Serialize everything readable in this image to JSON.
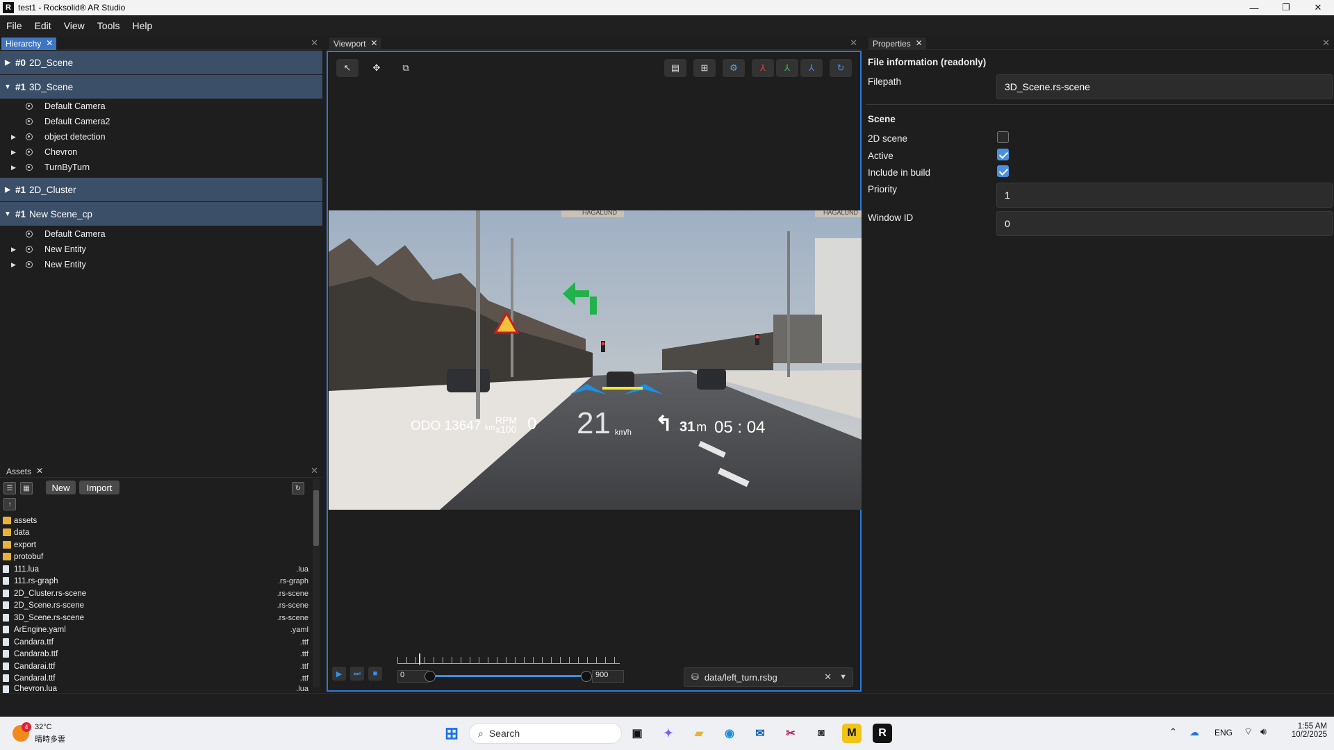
{
  "window": {
    "title": "test1 - Rocksolid® AR Studio",
    "logo": "R",
    "minimize": "—",
    "maximize": "❐",
    "close": "✕"
  },
  "menu": [
    "File",
    "Edit",
    "View",
    "Tools",
    "Help"
  ],
  "hierarchy": {
    "tab": "Hierarchy",
    "scenes": [
      {
        "index": "#0",
        "name": "2D_Scene",
        "expanded": false
      },
      {
        "index": "#1",
        "name": "3D_Scene",
        "expanded": true,
        "entities": [
          "Default Camera",
          "Default Camera2",
          "object detection",
          "Chevron",
          "TurnByTurn"
        ]
      },
      {
        "index": "#1",
        "name": "2D_Cluster",
        "expanded": false
      },
      {
        "index": "#1",
        "name": "New Scene_cp",
        "expanded": true,
        "entities": [
          "Default Camera",
          "New Entity",
          "New Entity"
        ]
      }
    ]
  },
  "assets": {
    "tab": "Assets",
    "new_label": "New",
    "import_label": "Import",
    "items": [
      {
        "name": "assets",
        "ext": "",
        "type": "folder"
      },
      {
        "name": "data",
        "ext": "",
        "type": "folder"
      },
      {
        "name": "export",
        "ext": "",
        "type": "folder"
      },
      {
        "name": "protobuf",
        "ext": "",
        "type": "folder"
      },
      {
        "name": "111.lua",
        "ext": ".lua",
        "type": "file"
      },
      {
        "name": "111.rs-graph",
        "ext": ".rs-graph",
        "type": "file"
      },
      {
        "name": "2D_Cluster.rs-scene",
        "ext": ".rs-scene",
        "type": "file"
      },
      {
        "name": "2D_Scene.rs-scene",
        "ext": ".rs-scene",
        "type": "file"
      },
      {
        "name": "3D_Scene.rs-scene",
        "ext": ".rs-scene",
        "type": "file"
      },
      {
        "name": "ArEngine.yaml",
        "ext": ".yaml",
        "type": "file"
      },
      {
        "name": "Candara.ttf",
        "ext": ".ttf",
        "type": "file"
      },
      {
        "name": "Candarab.ttf",
        "ext": ".ttf",
        "type": "file"
      },
      {
        "name": "Candarai.ttf",
        "ext": ".ttf",
        "type": "file"
      },
      {
        "name": "Candaral.ttf",
        "ext": ".ttf",
        "type": "file"
      },
      {
        "name": "Chevron.lua",
        "ext": ".lua",
        "type": "file"
      }
    ]
  },
  "viewport": {
    "tab": "Viewport",
    "hud": {
      "odo_label": "ODO",
      "odo_value": "13647",
      "odo_unit": "km",
      "rpm_label": "RPM",
      "rpm_mult": "x100",
      "rpm_value": "0",
      "speed": "21",
      "speed_unit": "km/h",
      "turn_distance": "31",
      "turn_unit": "m",
      "time": "05 : 04"
    },
    "signs": {
      "left": "HAGALUND",
      "right": "HAGALUND"
    },
    "timeline": {
      "start": "0",
      "end": "900"
    },
    "source_file": "data/left_turn.rsbg"
  },
  "properties": {
    "tab": "Properties",
    "file_section": "File information (readonly)",
    "filepath_label": "Filepath",
    "filepath_value": "3D_Scene.rs-scene",
    "scene_section": "Scene",
    "scene_2d_label": "2D scene",
    "scene_2d": false,
    "active_label": "Active",
    "active": true,
    "include_label": "Include in build",
    "include": true,
    "priority_label": "Priority",
    "priority_value": "1",
    "window_id_label": "Window ID",
    "window_id_value": "0"
  },
  "taskbar": {
    "weather_temp": "32°C",
    "weather_desc": "晴時多雲",
    "weather_badge": "4",
    "search_placeholder": "Search",
    "lang": "ENG",
    "time": "1:55 AM",
    "date": "10/2/2025"
  },
  "colors": {
    "accent": "#3f76c4",
    "scene_header": "#3c4f68",
    "viewport_border": "#2f78d6",
    "hud_green": "#21b24b",
    "hud_blue": "#1e8fe0"
  }
}
